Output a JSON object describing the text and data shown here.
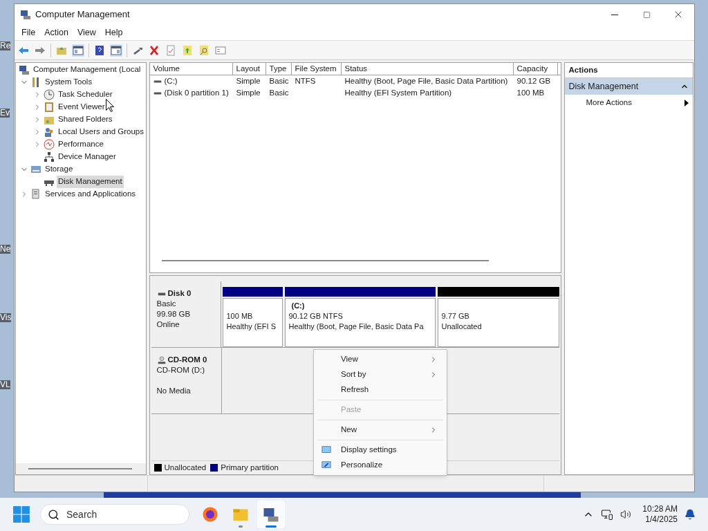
{
  "desktop_labels": [
    "Re",
    "Ev",
    "Ne",
    "Vis",
    "VL"
  ],
  "window": {
    "title": "Computer Management"
  },
  "menu": [
    "File",
    "Action",
    "View",
    "Help"
  ],
  "tree": [
    {
      "label": "Computer Management (Local",
      "selected": false,
      "children": [
        {
          "label": "System Tools",
          "expanded": true,
          "selected": false,
          "children": [
            {
              "label": "Task Scheduler",
              "expanded": false,
              "selected": false
            },
            {
              "label": "Event Viewer",
              "expanded": false,
              "selected": false
            },
            {
              "label": "Shared Folders",
              "expanded": false,
              "selected": false
            },
            {
              "label": "Local Users and Groups",
              "expanded": false,
              "selected": false
            },
            {
              "label": "Performance",
              "expanded": false,
              "selected": false
            },
            {
              "label": "Device Manager",
              "selected": false
            }
          ]
        },
        {
          "label": "Storage",
          "expanded": true,
          "selected": false,
          "children": [
            {
              "label": "Disk Management",
              "selected": true
            }
          ]
        },
        {
          "label": "Services and Applications",
          "expanded": false,
          "selected": false
        }
      ]
    }
  ],
  "volumes": {
    "columns": [
      "Volume",
      "Layout",
      "Type",
      "File System",
      "Status",
      "Capacity"
    ],
    "rows": [
      [
        "(C:)",
        "Simple",
        "Basic",
        "NTFS",
        "Healthy (Boot, Page File, Basic Data Partition)",
        "90.12 GB"
      ],
      [
        "(Disk 0 partition 1)",
        "Simple",
        "Basic",
        "",
        "Healthy (EFI System Partition)",
        "100 MB"
      ]
    ]
  },
  "disks": [
    {
      "kind": "disk",
      "name": "Disk 0",
      "lines": [
        "Basic",
        "99.98 GB"
      ],
      "status": "Online",
      "partitions": [
        {
          "color": "#000080",
          "lines": [
            "100 MB",
            "Healthy (EFI S"
          ]
        },
        {
          "color": "#000080",
          "label": "(C:)",
          "lines": [
            "90.12 GB NTFS",
            "Healthy (Boot, Page File, Basic Data Pa"
          ]
        },
        {
          "color": "#000000",
          "lines": [
            "9.77 GB",
            "Unallocated"
          ]
        }
      ]
    },
    {
      "kind": "cdrom",
      "name": "CD-ROM 0",
      "lines": [
        "CD-ROM (D:)"
      ],
      "status": "No Media"
    }
  ],
  "legend": [
    {
      "label": "Unallocated",
      "color": "#000000"
    },
    {
      "label": "Primary partition",
      "color": "#000080"
    }
  ],
  "actions": {
    "title": "Actions",
    "section": {
      "label": "Disk Management",
      "expanded": true
    },
    "items": [
      {
        "label": "More Actions",
        "submenu": true
      }
    ]
  },
  "context_menu": [
    {
      "kind": "item",
      "label": "View",
      "submenu": true,
      "disabled": false
    },
    {
      "kind": "item",
      "label": "Sort by",
      "submenu": true,
      "disabled": false
    },
    {
      "kind": "item",
      "label": "Refresh",
      "submenu": false,
      "disabled": false
    },
    {
      "kind": "separator"
    },
    {
      "kind": "item",
      "label": "Paste",
      "submenu": false,
      "disabled": true
    },
    {
      "kind": "separator"
    },
    {
      "kind": "item",
      "label": "New",
      "submenu": true,
      "disabled": false
    },
    {
      "kind": "separator"
    },
    {
      "kind": "icon-item",
      "label": "Display settings",
      "submenu": false,
      "disabled": false
    },
    {
      "kind": "icon-item",
      "label": "Personalize",
      "submenu": false,
      "disabled": false
    }
  ],
  "taskbar": {
    "search": {
      "placeholder": "Search"
    },
    "apps": [
      {
        "running": false,
        "selected": false
      },
      {
        "running": true,
        "selected": false
      },
      {
        "running": true,
        "selected": true
      }
    ],
    "time": "10:28 AM",
    "date": "1/4/2025"
  }
}
